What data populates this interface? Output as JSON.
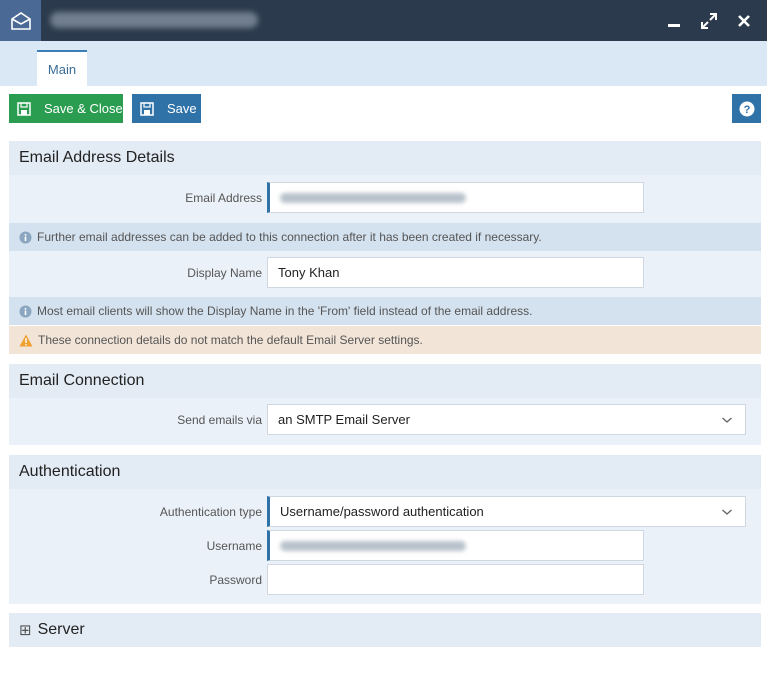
{
  "toolbar": {
    "save_close_label": "Save & Close",
    "save_label": "Save",
    "help_label": "?"
  },
  "tabs": [
    {
      "label": "Main"
    }
  ],
  "sections": {
    "email_details": {
      "title": "Email Address Details",
      "email_label": "Email Address",
      "email_info": "Further email addresses can be added to this connection after it has been created if necessary.",
      "display_name_label": "Display Name",
      "display_name_value": "Tony Khan",
      "display_info": "Most email clients will show the Display Name in the 'From' field instead of the email address.",
      "warning": "These connection details do not match the default Email Server settings."
    },
    "connection": {
      "title": "Email Connection",
      "send_via_label": "Send emails via",
      "send_via_value": "an SMTP Email Server"
    },
    "authentication": {
      "title": "Authentication",
      "auth_type_label": "Authentication type",
      "auth_type_value": "Username/password authentication",
      "username_label": "Username",
      "password_label": "Password",
      "password_value": ""
    },
    "server": {
      "title": "Server",
      "expand_symbol": "⊞"
    }
  },
  "colors": {
    "titlebar": "#2b3a4d",
    "accent_blue": "#2f72a8",
    "accent_green": "#2a9d50",
    "warning": "#f0a030"
  }
}
